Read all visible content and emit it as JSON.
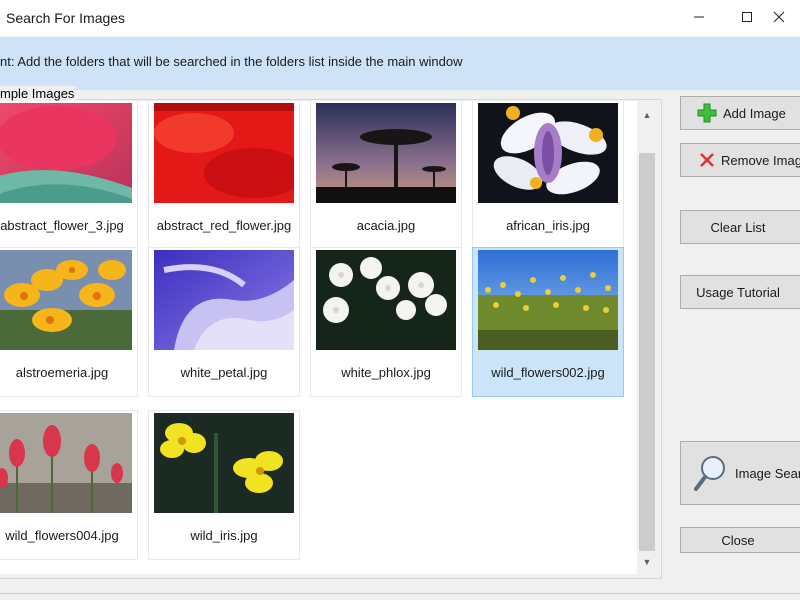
{
  "window": {
    "title": "Search For Images",
    "minimize_icon": "minimize-icon",
    "maximize_icon": "maximize-icon",
    "close_icon": "close-icon"
  },
  "hint": "nt: Add the folders that will be searched in the folders list inside the main window",
  "group_label": "mple Images",
  "images": [
    {
      "caption": "abstract_flower_3.jpg",
      "selected": false
    },
    {
      "caption": "abstract_red_flower.jpg",
      "selected": false
    },
    {
      "caption": "acacia.jpg",
      "selected": false
    },
    {
      "caption": "african_iris.jpg",
      "selected": false
    },
    {
      "caption": "alstroemeria.jpg",
      "selected": false
    },
    {
      "caption": "white_petal.jpg",
      "selected": false
    },
    {
      "caption": "white_phlox.jpg",
      "selected": false
    },
    {
      "caption": "wild_flowers002.jpg",
      "selected": true
    },
    {
      "caption": "wild_flowers004.jpg",
      "selected": false
    },
    {
      "caption": "wild_iris.jpg",
      "selected": false
    }
  ],
  "buttons": {
    "add_image": {
      "label": "Add Image",
      "icon": "plus-icon"
    },
    "remove_image": {
      "label": "Remove Image",
      "icon": "red-x-icon"
    },
    "clear_list": {
      "label": "Clear List"
    },
    "usage_tutorial": {
      "label": "Usage Tutorial"
    },
    "image_search": {
      "label": "Image Search",
      "icon": "magnifier-icon"
    },
    "close": {
      "label": "Close"
    }
  },
  "colors": {
    "hint_bar": "#cfe3f8",
    "selection": "#cce4f7",
    "add_icon": "#3fbf3f",
    "remove_icon": "#e03030"
  }
}
